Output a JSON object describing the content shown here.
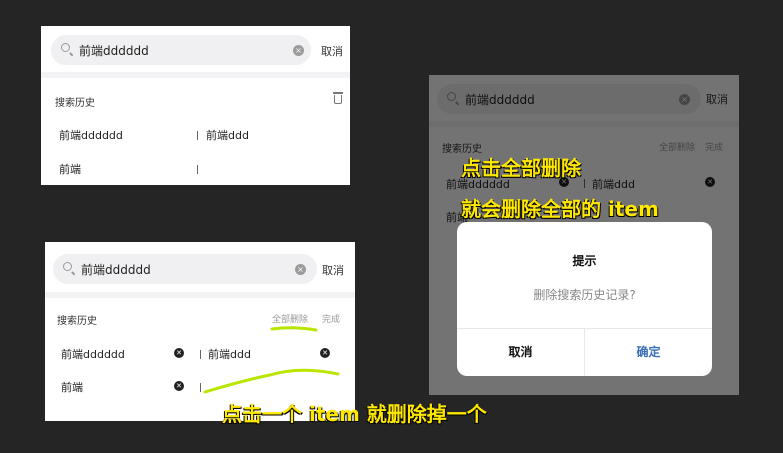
{
  "search": {
    "value": "前端dddddd",
    "cancel_label": "取消"
  },
  "history": {
    "title": "搜索历史",
    "delete_all_label": "全部删除",
    "done_label": "完成",
    "items": [
      "前端dddddd",
      "前端ddd",
      "前端"
    ]
  },
  "dialog": {
    "title": "提示",
    "message": "删除搜索历史记录?",
    "cancel_label": "取消",
    "confirm_label": "确定"
  },
  "captions": {
    "delete_all_line1": "点击全部删除",
    "delete_all_line2": "就会删除全部的 item",
    "delete_one": "点击一个 item 就删除掉一个"
  },
  "icons": {
    "search": "search-icon",
    "clear": "clear-icon",
    "trash": "trash-icon",
    "remove": "remove-item-icon"
  },
  "colors": {
    "background": "#252525",
    "caption": "#ffe800",
    "highlight_stroke": "#b8e600",
    "confirm": "#3a6fb5"
  }
}
